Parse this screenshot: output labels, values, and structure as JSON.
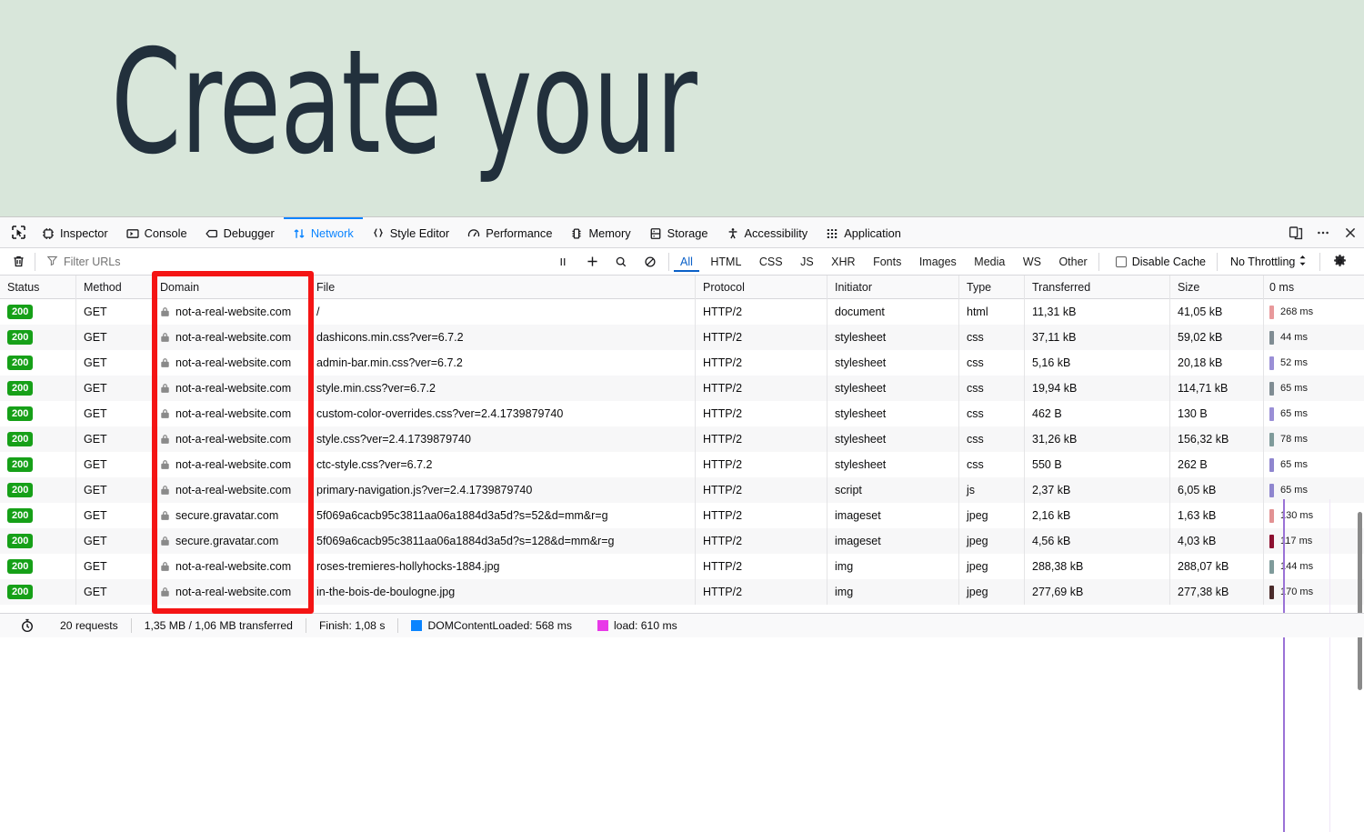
{
  "hero": {
    "title": "Create your",
    "bg_color": "#d8e6da",
    "text_color": "#22303c"
  },
  "devtools": {
    "picker_icon": "element-picker-icon",
    "tabs": [
      {
        "label": "Inspector",
        "icon": "inspector-icon",
        "active": false
      },
      {
        "label": "Console",
        "icon": "console-icon",
        "active": false
      },
      {
        "label": "Debugger",
        "icon": "debugger-icon",
        "active": false
      },
      {
        "label": "Network",
        "icon": "network-icon",
        "active": true
      },
      {
        "label": "Style Editor",
        "icon": "style-editor-icon",
        "active": false
      },
      {
        "label": "Performance",
        "icon": "performance-icon",
        "active": false
      },
      {
        "label": "Memory",
        "icon": "memory-icon",
        "active": false
      },
      {
        "label": "Storage",
        "icon": "storage-icon",
        "active": false
      },
      {
        "label": "Accessibility",
        "icon": "accessibility-icon",
        "active": false
      },
      {
        "label": "Application",
        "icon": "application-icon",
        "active": false
      }
    ],
    "right_buttons": [
      {
        "name": "responsive-design-mode-icon"
      },
      {
        "name": "meatball-menu-icon"
      },
      {
        "name": "close-icon"
      }
    ],
    "active_tab_color": "#0a84ff"
  },
  "toolbar": {
    "trash_icon": "trash-icon",
    "filter": {
      "placeholder": "Filter URLs",
      "value": "",
      "icon": "funnel-icon"
    },
    "pause_icon": "pause-icon",
    "plus_icon": "plus-icon",
    "search_icon": "search-icon",
    "block_icon": "block-icon",
    "types": [
      "All",
      "HTML",
      "CSS",
      "JS",
      "XHR",
      "Fonts",
      "Images",
      "Media",
      "WS",
      "Other"
    ],
    "active_type": "All",
    "disable_cache": {
      "label": "Disable Cache",
      "checked": false
    },
    "throttling": {
      "label": "No Throttling",
      "chevron": "updown-chevron-icon"
    },
    "settings_icon": "gear-icon"
  },
  "table": {
    "columns": [
      "Status",
      "Method",
      "Domain",
      "File",
      "Protocol",
      "Initiator",
      "Type",
      "Transferred",
      "Size"
    ],
    "timeline_header": "0 ms",
    "rows": [
      {
        "status": "200",
        "method": "GET",
        "domain": "not-a-real-website.com",
        "secure": true,
        "file": "/",
        "protocol": "HTTP/2",
        "initiator": "document",
        "type": "html",
        "transferred": "11,31 kB",
        "size": "41,05 kB",
        "time": "268 ms",
        "bar_color": "#e8999b"
      },
      {
        "status": "200",
        "method": "GET",
        "domain": "not-a-real-website.com",
        "secure": true,
        "file": "dashicons.min.css?ver=6.7.2",
        "protocol": "HTTP/2",
        "initiator": "stylesheet",
        "type": "css",
        "transferred": "37,11 kB",
        "size": "59,02 kB",
        "time": "44 ms",
        "bar_color": "#7f8c93"
      },
      {
        "status": "200",
        "method": "GET",
        "domain": "not-a-real-website.com",
        "secure": true,
        "file": "admin-bar.min.css?ver=6.7.2",
        "protocol": "HTTP/2",
        "initiator": "stylesheet",
        "type": "css",
        "transferred": "5,16 kB",
        "size": "20,18 kB",
        "time": "52 ms",
        "bar_color": "#9a8fd6"
      },
      {
        "status": "200",
        "method": "GET",
        "domain": "not-a-real-website.com",
        "secure": true,
        "file": "style.min.css?ver=6.7.2",
        "protocol": "HTTP/2",
        "initiator": "stylesheet",
        "type": "css",
        "transferred": "19,94 kB",
        "size": "114,71 kB",
        "time": "65 ms",
        "bar_color": "#7f8c93"
      },
      {
        "status": "200",
        "method": "GET",
        "domain": "not-a-real-website.com",
        "secure": true,
        "file": "custom-color-overrides.css?ver=2.4.1739879740",
        "protocol": "HTTP/2",
        "initiator": "stylesheet",
        "type": "css",
        "transferred": "462 B",
        "size": "130 B",
        "time": "65 ms",
        "bar_color": "#9a8fd6"
      },
      {
        "status": "200",
        "method": "GET",
        "domain": "not-a-real-website.com",
        "secure": true,
        "file": "style.css?ver=2.4.1739879740",
        "protocol": "HTTP/2",
        "initiator": "stylesheet",
        "type": "css",
        "transferred": "31,26 kB",
        "size": "156,32 kB",
        "time": "78 ms",
        "bar_color": "#7f9b9b"
      },
      {
        "status": "200",
        "method": "GET",
        "domain": "not-a-real-website.com",
        "secure": true,
        "file": "ctc-style.css?ver=6.7.2",
        "protocol": "HTTP/2",
        "initiator": "stylesheet",
        "type": "css",
        "transferred": "550 B",
        "size": "262 B",
        "time": "65 ms",
        "bar_color": "#8f86cf"
      },
      {
        "status": "200",
        "method": "GET",
        "domain": "not-a-real-website.com",
        "secure": true,
        "file": "primary-navigation.js?ver=2.4.1739879740",
        "protocol": "HTTP/2",
        "initiator": "script",
        "type": "js",
        "transferred": "2,37 kB",
        "size": "6,05 kB",
        "time": "65 ms",
        "bar_color": "#8f86cf"
      },
      {
        "status": "200",
        "method": "GET",
        "domain": "secure.gravatar.com",
        "secure": true,
        "file": "5f069a6cacb95c3811aa06a1884d3a5d?s=52&d=mm&r=g",
        "protocol": "HTTP/2",
        "initiator": "imageset",
        "type": "jpeg",
        "transferred": "2,16 kB",
        "size": "1,63 kB",
        "time": "130 ms",
        "bar_color": "#e29293"
      },
      {
        "status": "200",
        "method": "GET",
        "domain": "secure.gravatar.com",
        "secure": true,
        "file": "5f069a6cacb95c3811aa06a1884d3a5d?s=128&d=mm&r=g",
        "protocol": "HTTP/2",
        "initiator": "imageset",
        "type": "jpeg",
        "transferred": "4,56 kB",
        "size": "4,03 kB",
        "time": "117 ms",
        "bar_color": "#8c1030"
      },
      {
        "status": "200",
        "method": "GET",
        "domain": "not-a-real-website.com",
        "secure": true,
        "file": "roses-tremieres-hollyhocks-1884.jpg",
        "protocol": "HTTP/2",
        "initiator": "img",
        "type": "jpeg",
        "transferred": "288,38 kB",
        "size": "288,07 kB",
        "time": "144 ms",
        "bar_color": "#7f9b9b"
      },
      {
        "status": "200",
        "method": "GET",
        "domain": "not-a-real-website.com",
        "secure": true,
        "file": "in-the-bois-de-boulogne.jpg",
        "protocol": "HTTP/2",
        "initiator": "img",
        "type": "jpeg",
        "transferred": "277,69 kB",
        "size": "277,38 kB",
        "time": "170 ms",
        "bar_color": "#4a2b2b"
      }
    ]
  },
  "statusbar": {
    "clock_icon": "stopwatch-icon",
    "requests": "20 requests",
    "transferred": "1,35 MB / 1,06 MB transferred",
    "finish": "Finish: 1,08 s",
    "domcontentloaded": {
      "label": "DOMContentLoaded: 568 ms",
      "color": "#0a84ff"
    },
    "load": {
      "label": "load: 610 ms",
      "color": "#e839e8"
    }
  },
  "annotation": {
    "highlight_color": "#f41414",
    "target_column": "Domain"
  }
}
